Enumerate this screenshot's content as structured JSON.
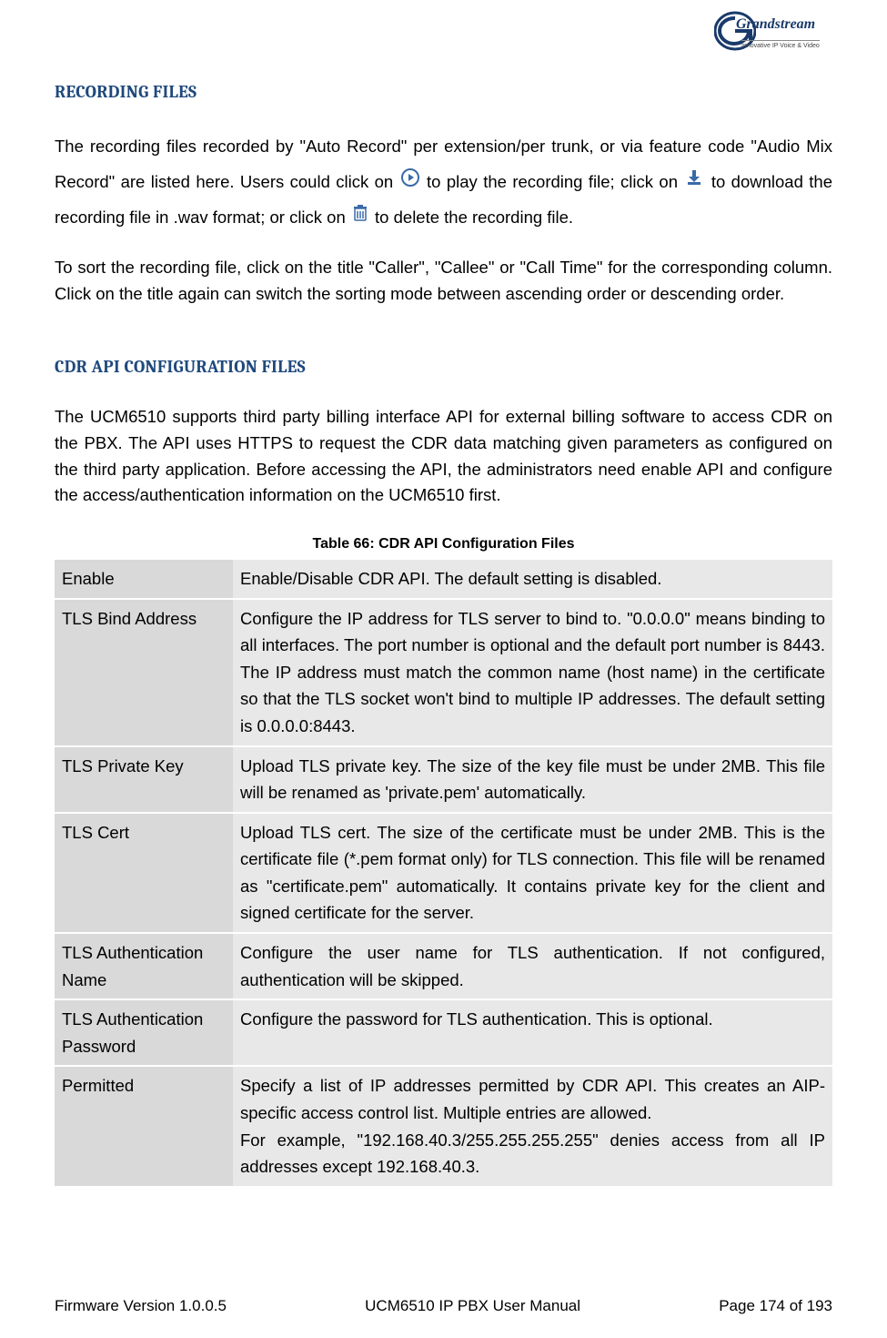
{
  "logo": {
    "brand": "Grandstream",
    "tagline": "Innovative IP Voice & Video"
  },
  "section1": {
    "title": "RECORDING FILES",
    "para1_a": "The recording files recorded by \"Auto Record\" per extension/per trunk, or via feature code \"Audio Mix Record\" are listed here. Users could click on ",
    "para1_b": " to play the recording file; click on ",
    "para1_c": " to download the recording file in .wav format; or click on ",
    "para1_d": " to delete the recording file.",
    "para2": "To sort the recording file, click on the title \"Caller\", \"Callee\" or \"Call Time\" for the corresponding column. Click on the title again can switch the sorting mode between ascending order or descending order."
  },
  "section2": {
    "title": "CDR API CONFIGURATION FILES",
    "para1": "The UCM6510 supports third party billing interface API for external billing software to access CDR on the PBX. The API uses HTTPS to request the CDR data matching given parameters as configured on the third party application. Before accessing the API, the administrators need enable API and configure the access/authentication information on the UCM6510 first.",
    "table_caption": "Table 66: CDR API Configuration Files",
    "rows": [
      {
        "key": "Enable",
        "val": "Enable/Disable CDR API. The default setting is disabled."
      },
      {
        "key": "TLS Bind Address",
        "val": "Configure the IP address for TLS server to bind to. \"0.0.0.0\" means binding to all interfaces. The port number is optional and the default port number is 8443. The IP address must match the common name (host name) in the certificate so that the TLS socket won't bind to multiple IP addresses. The default setting is 0.0.0.0:8443."
      },
      {
        "key": "TLS Private Key",
        "val": "Upload TLS private key. The size of the key file must be under 2MB. This file will be renamed as 'private.pem' automatically."
      },
      {
        "key": "TLS Cert",
        "val": "Upload TLS cert. The size of the certificate must be under 2MB. This is the certificate file (*.pem format only) for TLS connection. This file will be renamed as \"certificate.pem\" automatically. It contains private key for the client and signed certificate for the server."
      },
      {
        "key": "TLS Authentication Name",
        "val": "Configure the user name for TLS authentication. If not configured, authentication will be skipped."
      },
      {
        "key": "TLS Authentication Password",
        "val": "Configure the password for TLS authentication. This is optional."
      },
      {
        "key": "Permitted",
        "val": "Specify a list of IP addresses permitted by CDR API. This creates an AIP-specific access control list. Multiple entries are allowed.\nFor example, \"192.168.40.3/255.255.255.255\" denies access from all IP addresses except 192.168.40.3."
      }
    ]
  },
  "footer": {
    "left": "Firmware Version 1.0.0.5",
    "center": "UCM6510 IP PBX User Manual",
    "right": "Page 174 of 193"
  }
}
